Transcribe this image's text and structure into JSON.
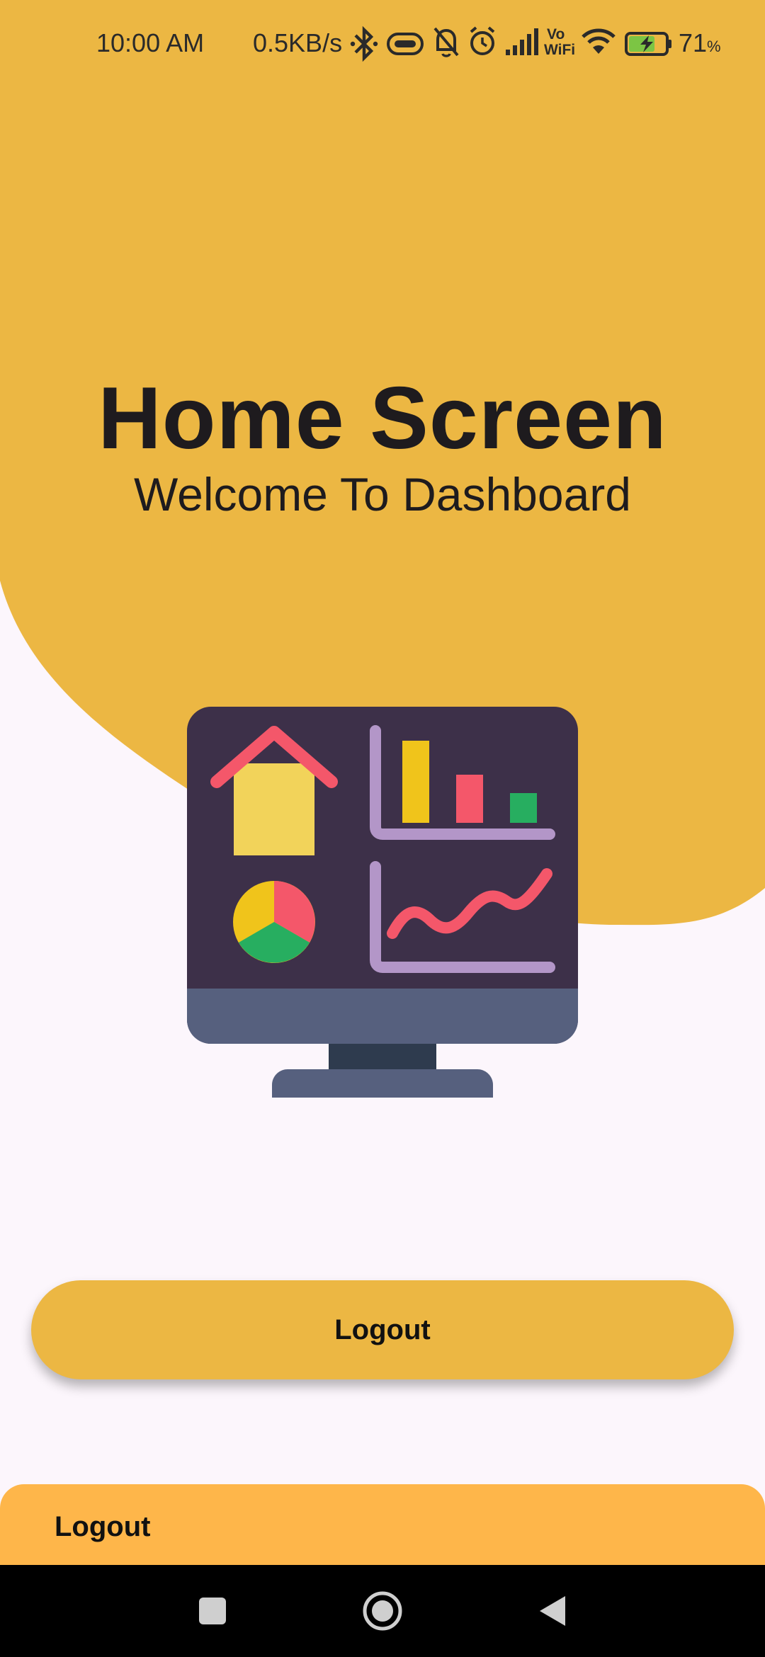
{
  "status_bar": {
    "time": "10:00 AM",
    "network_speed": "0.5KB/s",
    "battery_percent": "71",
    "battery_unit": "%",
    "icons": [
      "bluetooth-icon",
      "vibrate-icon",
      "mute-icon",
      "alarm-icon",
      "signal-icon",
      "vowifi-icon",
      "wifi-icon",
      "battery-charging-icon"
    ],
    "vowifi_top": "Vo",
    "vowifi_bottom": "WiFi"
  },
  "header": {
    "title": "Home Screen",
    "subtitle": "Welcome To Dashboard"
  },
  "illustration": {
    "icon": "dashboard-monitor-icon"
  },
  "main": {
    "logout_label": "Logout"
  },
  "bottom_sheet": {
    "label": "Logout"
  },
  "nav": {
    "icons": [
      "recents-icon",
      "home-icon",
      "back-icon"
    ]
  },
  "colors": {
    "accent": "#ECB743",
    "background": "#FCF6FC",
    "sheet": "#FEB64A",
    "text": "#1E1B1E"
  }
}
